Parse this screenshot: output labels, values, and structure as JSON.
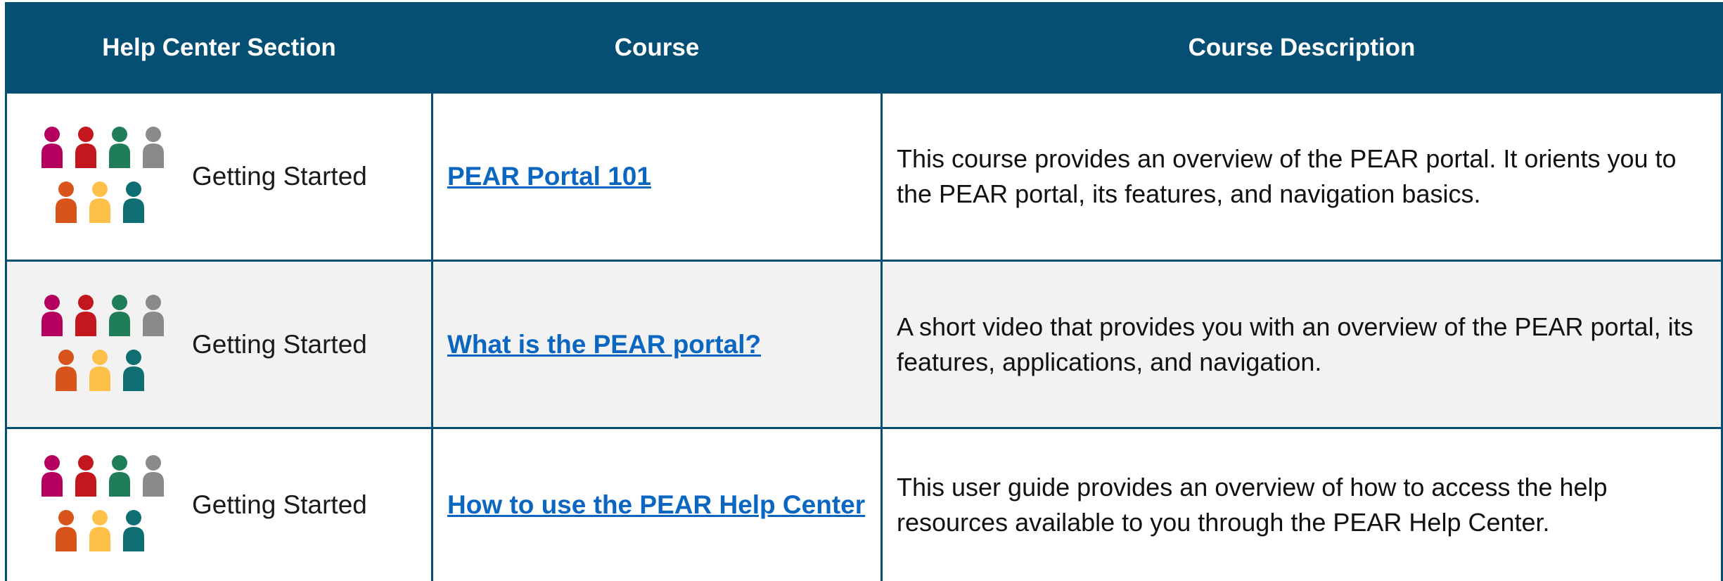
{
  "table": {
    "headers": [
      "Help Center Section",
      "Course",
      "Course Description"
    ],
    "rows": [
      {
        "section": "Getting Started",
        "icon": "people-group-icon",
        "course": "PEAR Portal 101",
        "description": "This course provides an overview of the PEAR portal. It orients you to the PEAR portal, its features, and navigation basics."
      },
      {
        "section": "Getting Started",
        "icon": "people-group-icon",
        "course": "What is the PEAR portal?",
        "description": "A short video that provides you with an overview of the PEAR portal, its features, applications, and navigation."
      },
      {
        "section": "Getting Started",
        "icon": "people-group-icon",
        "course": "How to use the PEAR Help Center",
        "description": "This user guide provides an overview of how to access the help resources available to you through the PEAR Help Center."
      }
    ]
  },
  "colors": {
    "header_bg": "#054e74",
    "link": "#0b66c2",
    "alt_row": "#f2f2f2",
    "people": [
      "#b5005f",
      "#c3161d",
      "#1f7d58",
      "#8a8a8a",
      "#d9541a",
      "#ffc04a",
      "#0e6e72"
    ]
  }
}
